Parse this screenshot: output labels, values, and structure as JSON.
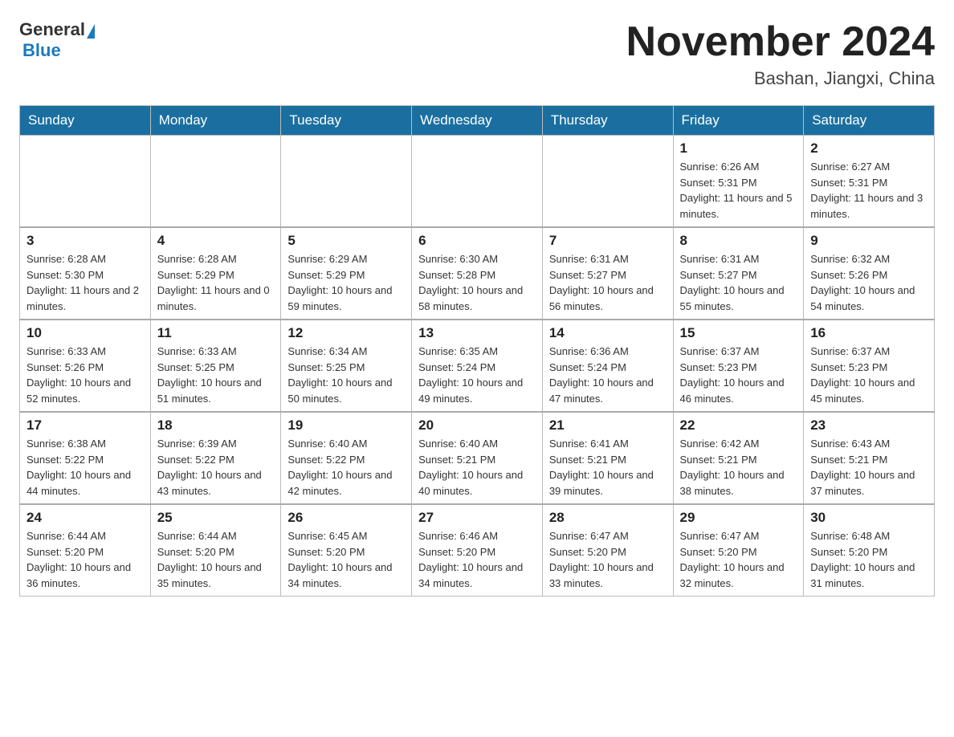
{
  "header": {
    "logo": {
      "general": "General",
      "blue": "Blue"
    },
    "title": "November 2024",
    "location": "Bashan, Jiangxi, China"
  },
  "weekdays": [
    "Sunday",
    "Monday",
    "Tuesday",
    "Wednesday",
    "Thursday",
    "Friday",
    "Saturday"
  ],
  "weeks": [
    [
      {
        "day": "",
        "info": ""
      },
      {
        "day": "",
        "info": ""
      },
      {
        "day": "",
        "info": ""
      },
      {
        "day": "",
        "info": ""
      },
      {
        "day": "",
        "info": ""
      },
      {
        "day": "1",
        "info": "Sunrise: 6:26 AM\nSunset: 5:31 PM\nDaylight: 11 hours and 5 minutes."
      },
      {
        "day": "2",
        "info": "Sunrise: 6:27 AM\nSunset: 5:31 PM\nDaylight: 11 hours and 3 minutes."
      }
    ],
    [
      {
        "day": "3",
        "info": "Sunrise: 6:28 AM\nSunset: 5:30 PM\nDaylight: 11 hours and 2 minutes."
      },
      {
        "day": "4",
        "info": "Sunrise: 6:28 AM\nSunset: 5:29 PM\nDaylight: 11 hours and 0 minutes."
      },
      {
        "day": "5",
        "info": "Sunrise: 6:29 AM\nSunset: 5:29 PM\nDaylight: 10 hours and 59 minutes."
      },
      {
        "day": "6",
        "info": "Sunrise: 6:30 AM\nSunset: 5:28 PM\nDaylight: 10 hours and 58 minutes."
      },
      {
        "day": "7",
        "info": "Sunrise: 6:31 AM\nSunset: 5:27 PM\nDaylight: 10 hours and 56 minutes."
      },
      {
        "day": "8",
        "info": "Sunrise: 6:31 AM\nSunset: 5:27 PM\nDaylight: 10 hours and 55 minutes."
      },
      {
        "day": "9",
        "info": "Sunrise: 6:32 AM\nSunset: 5:26 PM\nDaylight: 10 hours and 54 minutes."
      }
    ],
    [
      {
        "day": "10",
        "info": "Sunrise: 6:33 AM\nSunset: 5:26 PM\nDaylight: 10 hours and 52 minutes."
      },
      {
        "day": "11",
        "info": "Sunrise: 6:33 AM\nSunset: 5:25 PM\nDaylight: 10 hours and 51 minutes."
      },
      {
        "day": "12",
        "info": "Sunrise: 6:34 AM\nSunset: 5:25 PM\nDaylight: 10 hours and 50 minutes."
      },
      {
        "day": "13",
        "info": "Sunrise: 6:35 AM\nSunset: 5:24 PM\nDaylight: 10 hours and 49 minutes."
      },
      {
        "day": "14",
        "info": "Sunrise: 6:36 AM\nSunset: 5:24 PM\nDaylight: 10 hours and 47 minutes."
      },
      {
        "day": "15",
        "info": "Sunrise: 6:37 AM\nSunset: 5:23 PM\nDaylight: 10 hours and 46 minutes."
      },
      {
        "day": "16",
        "info": "Sunrise: 6:37 AM\nSunset: 5:23 PM\nDaylight: 10 hours and 45 minutes."
      }
    ],
    [
      {
        "day": "17",
        "info": "Sunrise: 6:38 AM\nSunset: 5:22 PM\nDaylight: 10 hours and 44 minutes."
      },
      {
        "day": "18",
        "info": "Sunrise: 6:39 AM\nSunset: 5:22 PM\nDaylight: 10 hours and 43 minutes."
      },
      {
        "day": "19",
        "info": "Sunrise: 6:40 AM\nSunset: 5:22 PM\nDaylight: 10 hours and 42 minutes."
      },
      {
        "day": "20",
        "info": "Sunrise: 6:40 AM\nSunset: 5:21 PM\nDaylight: 10 hours and 40 minutes."
      },
      {
        "day": "21",
        "info": "Sunrise: 6:41 AM\nSunset: 5:21 PM\nDaylight: 10 hours and 39 minutes."
      },
      {
        "day": "22",
        "info": "Sunrise: 6:42 AM\nSunset: 5:21 PM\nDaylight: 10 hours and 38 minutes."
      },
      {
        "day": "23",
        "info": "Sunrise: 6:43 AM\nSunset: 5:21 PM\nDaylight: 10 hours and 37 minutes."
      }
    ],
    [
      {
        "day": "24",
        "info": "Sunrise: 6:44 AM\nSunset: 5:20 PM\nDaylight: 10 hours and 36 minutes."
      },
      {
        "day": "25",
        "info": "Sunrise: 6:44 AM\nSunset: 5:20 PM\nDaylight: 10 hours and 35 minutes."
      },
      {
        "day": "26",
        "info": "Sunrise: 6:45 AM\nSunset: 5:20 PM\nDaylight: 10 hours and 34 minutes."
      },
      {
        "day": "27",
        "info": "Sunrise: 6:46 AM\nSunset: 5:20 PM\nDaylight: 10 hours and 34 minutes."
      },
      {
        "day": "28",
        "info": "Sunrise: 6:47 AM\nSunset: 5:20 PM\nDaylight: 10 hours and 33 minutes."
      },
      {
        "day": "29",
        "info": "Sunrise: 6:47 AM\nSunset: 5:20 PM\nDaylight: 10 hours and 32 minutes."
      },
      {
        "day": "30",
        "info": "Sunrise: 6:48 AM\nSunset: 5:20 PM\nDaylight: 10 hours and 31 minutes."
      }
    ]
  ]
}
